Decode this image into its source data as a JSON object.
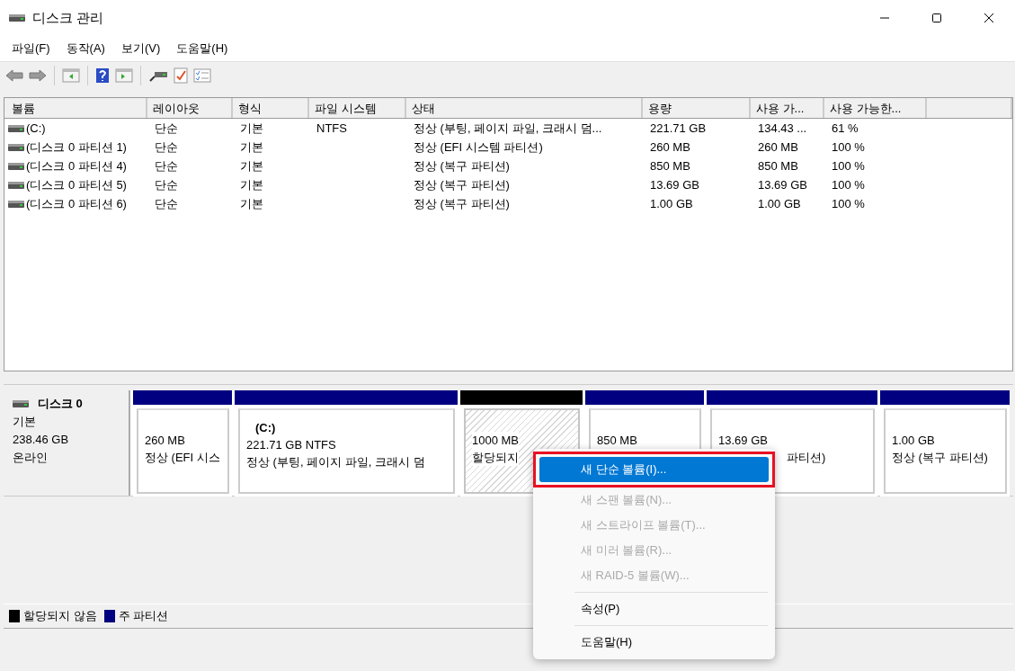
{
  "window": {
    "title": "디스크 관리"
  },
  "menu_bar": [
    "파일(F)",
    "동작(A)",
    "보기(V)",
    "도움말(H)"
  ],
  "table": {
    "columns": [
      "볼륨",
      "레이아웃",
      "형식",
      "파일 시스템",
      "상태",
      "용량",
      "사용 가...",
      "사용 가능한..."
    ],
    "rows": [
      {
        "cells": [
          " (C:)",
          "단순",
          "기본",
          "NTFS",
          "정상 (부팅, 페이지 파일, 크래시 덤...",
          "221.71 GB",
          "134.43 ...",
          "61 %"
        ]
      },
      {
        "cells": [
          "(디스크 0 파티션 1)",
          "단순",
          "기본",
          "",
          "정상 (EFI 시스템 파티션)",
          "260 MB",
          "260 MB",
          "100 %"
        ]
      },
      {
        "cells": [
          "(디스크 0 파티션 4)",
          "단순",
          "기본",
          "",
          "정상 (복구 파티션)",
          "850 MB",
          "850 MB",
          "100 %"
        ]
      },
      {
        "cells": [
          "(디스크 0 파티션 5)",
          "단순",
          "기본",
          "",
          "정상 (복구 파티션)",
          "13.69 GB",
          "13.69 GB",
          "100 %"
        ]
      },
      {
        "cells": [
          "(디스크 0 파티션 6)",
          "단순",
          "기본",
          "",
          "정상 (복구 파티션)",
          "1.00 GB",
          "1.00 GB",
          "100 %"
        ]
      }
    ]
  },
  "disk": {
    "name": "디스크 0",
    "type": "기본",
    "size": "238.46 GB",
    "status": "온라인",
    "partitions": [
      {
        "kind": "primary",
        "size": "260 MB",
        "status": "정상 (EFI 시스"
      },
      {
        "kind": "primary",
        "title": "(C:)",
        "size": "221.71 GB NTFS",
        "status": "정상 (부팅, 페이지 파일, 크래시 덤"
      },
      {
        "kind": "unallocated",
        "size": "1000 MB",
        "status": "할당되지"
      },
      {
        "kind": "primary",
        "size": "850 MB"
      },
      {
        "kind": "primary",
        "size": "13.69 GB",
        "status": "파티션)",
        "status_covered": true
      },
      {
        "kind": "primary",
        "size": "1.00 GB",
        "status": "정상 (복구 파티션)"
      }
    ]
  },
  "legend": [
    {
      "label": "할당되지 않음",
      "color": "#000000"
    },
    {
      "label": "주 파티션",
      "color": "#000080"
    }
  ],
  "context_menu": [
    {
      "kind": "item",
      "label": "새 단순 볼륨(I)...",
      "selected": true,
      "disabled": false,
      "outlined": true
    },
    {
      "kind": "item",
      "label": "새 스팬 볼륨(N)...",
      "selected": false,
      "disabled": true,
      "outlined": false
    },
    {
      "kind": "item",
      "label": "새 스트라이프 볼륨(T)...",
      "selected": false,
      "disabled": true,
      "outlined": false
    },
    {
      "kind": "item",
      "label": "새 미러 볼륨(R)...",
      "selected": false,
      "disabled": true,
      "outlined": false
    },
    {
      "kind": "item",
      "label": "새 RAID-5 볼륨(W)...",
      "selected": false,
      "disabled": true,
      "outlined": false
    },
    {
      "kind": "separator"
    },
    {
      "kind": "item",
      "label": "속성(P)",
      "selected": false,
      "disabled": false,
      "outlined": false
    },
    {
      "kind": "separator"
    },
    {
      "kind": "item",
      "label": "도움말(H)",
      "selected": false,
      "disabled": false,
      "outlined": false
    }
  ]
}
